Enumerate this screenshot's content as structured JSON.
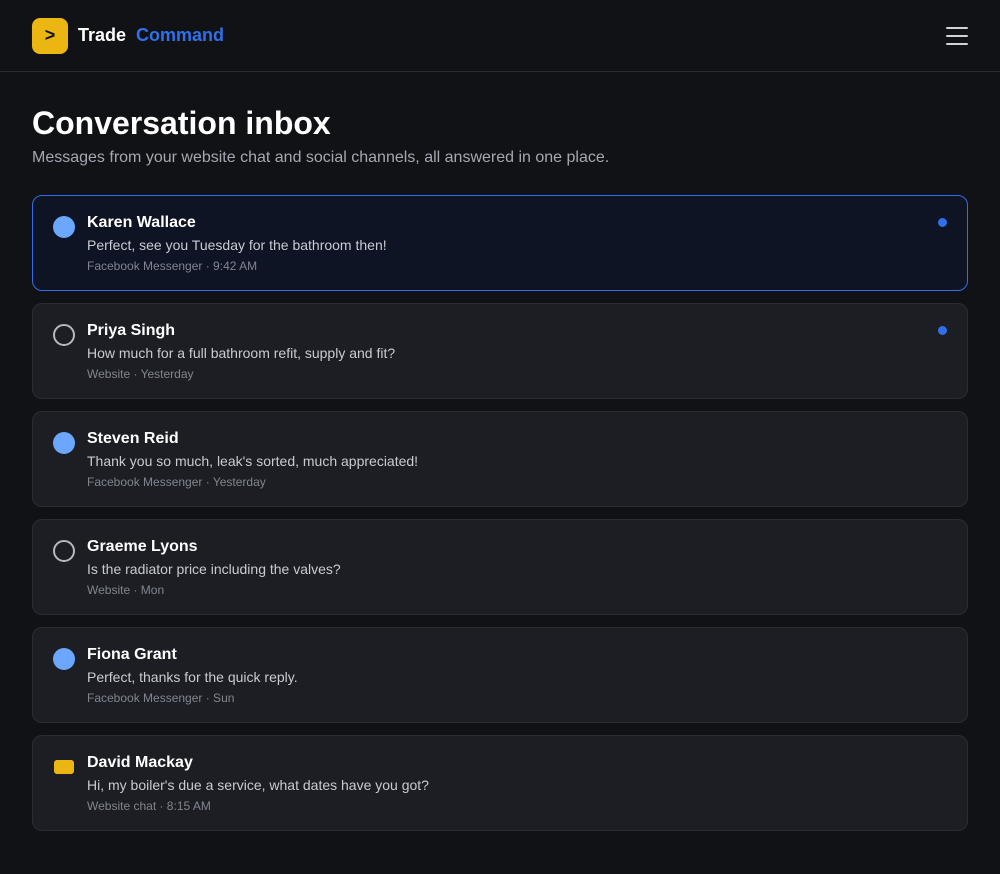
{
  "brand": {
    "logo_glyph": ">",
    "name_part1": "Trade",
    "name_part2": "Command",
    "logo_color": "#ecb612",
    "accent_color": "#2f6fe9"
  },
  "header": {
    "menu_icon": "hamburger-menu-icon"
  },
  "page": {
    "title": "Conversation inbox",
    "subtitle": "Messages from your website chat and social channels, all answered in one place."
  },
  "conversations": [
    {
      "name": "Karen Wallace",
      "preview": "Perfect, see you Tuesday for the bathroom then!",
      "source": "Facebook Messenger",
      "time": "9:42 AM",
      "meta": "Facebook Messenger · 9:42 AM",
      "channel_icon": "facebook-messenger-icon",
      "unread": true,
      "selected": true
    },
    {
      "name": "Priya Singh",
      "preview": "How much for a full bathroom refit, supply and fit?",
      "source": "Website",
      "time": "Yesterday",
      "meta": "Website · Yesterday",
      "channel_icon": "website-icon",
      "unread": true,
      "selected": false
    },
    {
      "name": "Steven Reid",
      "preview": "Thank you so much, leak's sorted, much appreciated!",
      "source": "Facebook Messenger",
      "time": "Yesterday",
      "meta": "Facebook Messenger · Yesterday",
      "channel_icon": "facebook-messenger-icon",
      "unread": false,
      "selected": false
    },
    {
      "name": "Graeme Lyons",
      "preview": "Is the radiator price including the valves?",
      "source": "Website",
      "time": "Mon",
      "meta": "Website · Mon",
      "channel_icon": "website-icon",
      "unread": false,
      "selected": false
    },
    {
      "name": "Fiona Grant",
      "preview": "Perfect, thanks for the quick reply.",
      "source": "Facebook Messenger",
      "time": "Sun",
      "meta": "Facebook Messenger · Sun",
      "channel_icon": "facebook-messenger-icon",
      "unread": false,
      "selected": false
    },
    {
      "name": "David Mackay",
      "preview": "Hi, my boiler's due a service, what dates have you got?",
      "source": "Website chat",
      "time": "8:15 AM",
      "meta": "Website chat · 8:15 AM",
      "channel_icon": "website-chat-icon",
      "unread": false,
      "selected": false
    }
  ]
}
